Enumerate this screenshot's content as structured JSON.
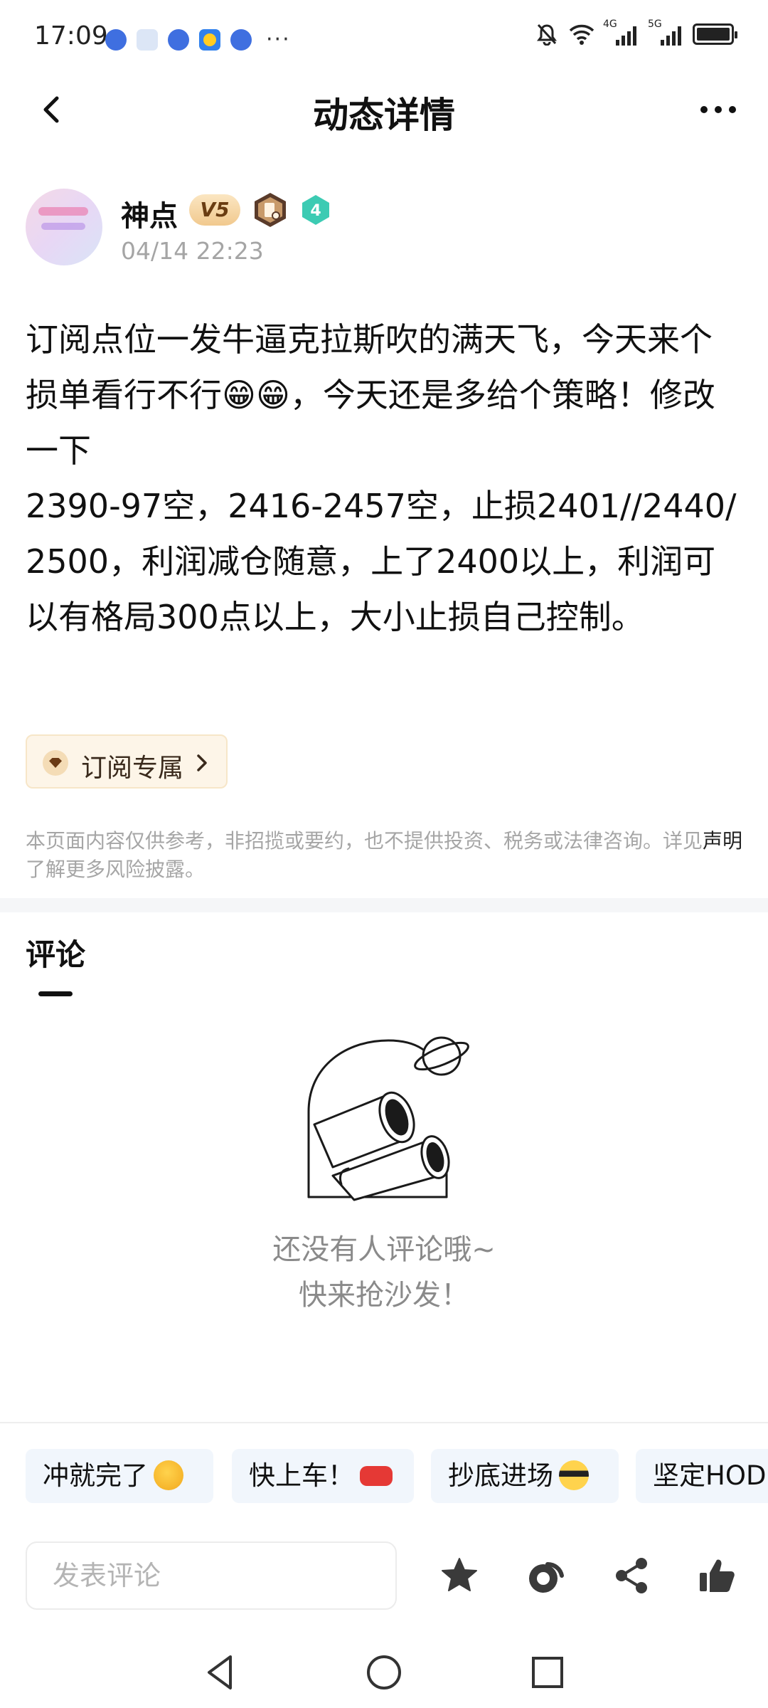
{
  "status_bar": {
    "time": "17:09",
    "more": "···",
    "network_1": "4G",
    "network_2": "5G"
  },
  "header": {
    "title": "动态详情",
    "back_icon": "chevron-left-icon",
    "more_icon": "more-dots-icon"
  },
  "author": {
    "name": "神点",
    "vip_level": "V5",
    "level_number": "4",
    "time": "04/14 22:23"
  },
  "post": {
    "content": "订阅点位一发牛逼克拉斯吹的满天飞，今天来个损单看行不行😁😁，今天还是多给个策略！修改一下\n2390-97空，2416-2457空，止损2401//2440/2500，利润减仓随意，上了2400以上，利润可以有格局300点以上，大小止损自己控制。"
  },
  "subscribe": {
    "label": "订阅专属",
    "icon": "diamond-icon"
  },
  "disclaimer": {
    "prefix": "本页面内容仅供参考，非招揽或要约，也不提供投资、税务或法律咨询。详见",
    "link": "声明",
    "suffix": "了解更多风险披露。"
  },
  "comments": {
    "title": "评论",
    "empty_line1": "还没有人评论哦~",
    "empty_line2": "快来抢沙发！",
    "illustration_icon": "telescope-icon"
  },
  "quick_replies": [
    {
      "label": "冲就完了",
      "emoji": "👊"
    },
    {
      "label": "快上车！",
      "emoji": "🚗"
    },
    {
      "label": "抄底进场",
      "emoji": "😎"
    },
    {
      "label": "坚定HODL",
      "emoji": ""
    }
  ],
  "comment_bar": {
    "placeholder": "发表评论",
    "actions": [
      "star-icon",
      "tip-icon",
      "share-icon",
      "thumb-up-icon"
    ]
  },
  "nav_bar": {
    "buttons": [
      "back-triangle-icon",
      "home-circle-icon",
      "recents-square-icon"
    ]
  },
  "colors": {
    "primary_text": "#111111",
    "muted_text": "#a6a6a6",
    "vip_gold": "#f1c98e",
    "level_teal": "#3ccbb3",
    "chip_bg": "#f1f6fc",
    "subscribe_bg": "#fdf5e8"
  }
}
